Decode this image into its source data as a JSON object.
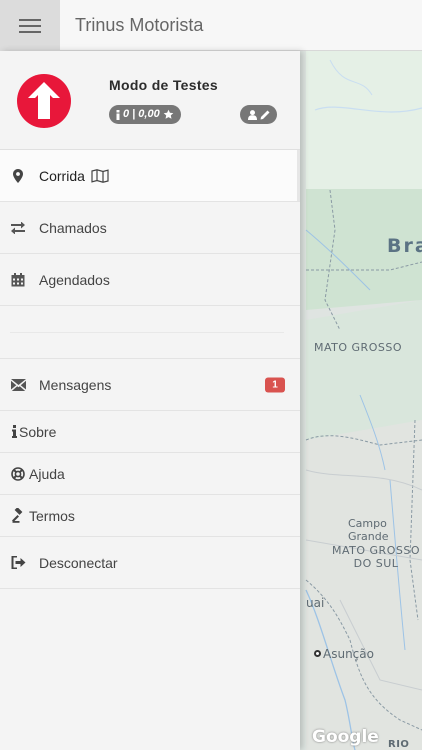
{
  "header": {
    "title": "Trinus Motorista",
    "menu_icon": "hamburger-menu-icon"
  },
  "profile": {
    "name": "Modo de Testes",
    "rating_text": "0 | 0,00",
    "logo_icon": "trinus-arrow-up-logo",
    "edit_icons": [
      "user-icon",
      "pencil-icon"
    ]
  },
  "menu": {
    "corrida": "Corrida",
    "chamados": "Chamados",
    "agendados": "Agendados",
    "mensagens": "Mensagens",
    "mensagens_count": "1",
    "sobre": "Sobre",
    "ajuda": "Ajuda",
    "termos": "Termos",
    "desconectar": "Desconectar"
  },
  "map": {
    "labels": {
      "brasil": "Bra",
      "mato_grosso": "MATO GROSSO",
      "campo_grande": "Campo Grande",
      "ms_line1": "MATO GROSSO",
      "ms_line2": "DO SUL",
      "paraguai": "uai",
      "asuncion": "Asunção",
      "rio": "RIO G",
      "google": "Google"
    }
  },
  "colors": {
    "brand_red": "#e8173a",
    "badge_gray": "#777777",
    "notification_red": "#d9534f"
  }
}
